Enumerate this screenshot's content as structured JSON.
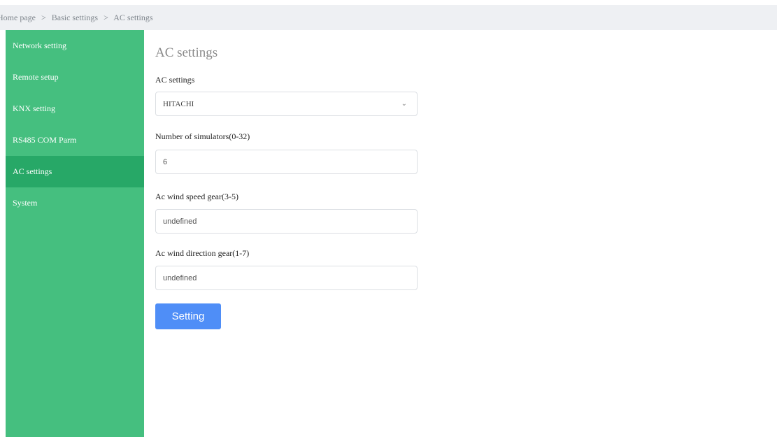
{
  "breadcrumb": {
    "items": [
      "Home page",
      "Basic settings",
      "AC settings"
    ],
    "separator": ">"
  },
  "sidebar": {
    "items": [
      {
        "label": "Network setting"
      },
      {
        "label": "Remote setup"
      },
      {
        "label": "KNX setting"
      },
      {
        "label": "RS485 COM Parm"
      },
      {
        "label": "AC settings",
        "active": true
      },
      {
        "label": "System"
      }
    ]
  },
  "main": {
    "title": "AC settings",
    "fields": [
      {
        "label": "AC settings",
        "value": "HITACHI",
        "type": "select"
      },
      {
        "label": "Number of simulators(0-32)",
        "value": "6"
      },
      {
        "label": "Ac wind speed gear(3-5)",
        "value": "undefined"
      },
      {
        "label": "Ac wind direction gear(1-7)",
        "value": "undefined"
      }
    ],
    "submit_label": "Setting"
  },
  "colors": {
    "sidebar": "#45bf7f",
    "sidebar_active": "#27a867",
    "button": "#4f8ef7",
    "breadcrumb_bg": "#eef0f3"
  }
}
